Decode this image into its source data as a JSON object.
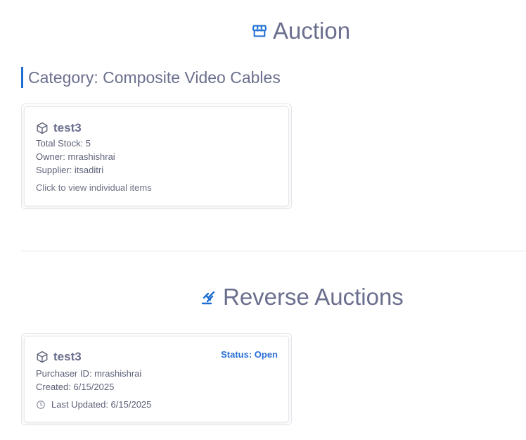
{
  "auction": {
    "title": "Auction",
    "icon": "storefront-icon",
    "category_heading": "Category: Composite Video Cables",
    "card": {
      "icon": "box-icon",
      "name": "test3",
      "total_stock": "Total Stock: 5",
      "owner": "Owner: mrashishrai",
      "supplier": "Supplier: itsaditri",
      "hint": "Click to view individual items"
    }
  },
  "reverse_auctions": {
    "title": "Reverse Auctions",
    "icon": "gavel-icon",
    "card": {
      "icon": "box-icon",
      "name": "test3",
      "status": "Status: Open",
      "purchaser": "Purchaser ID: mrashishrai",
      "created": "Created: 6/15/2025",
      "updated_icon": "clock-icon",
      "last_updated": "Last Updated: 6/15/2025"
    }
  },
  "colors": {
    "accent": "#1e6fd1",
    "status": "#2a6fd6",
    "heading_text": "#6b6f8e"
  }
}
